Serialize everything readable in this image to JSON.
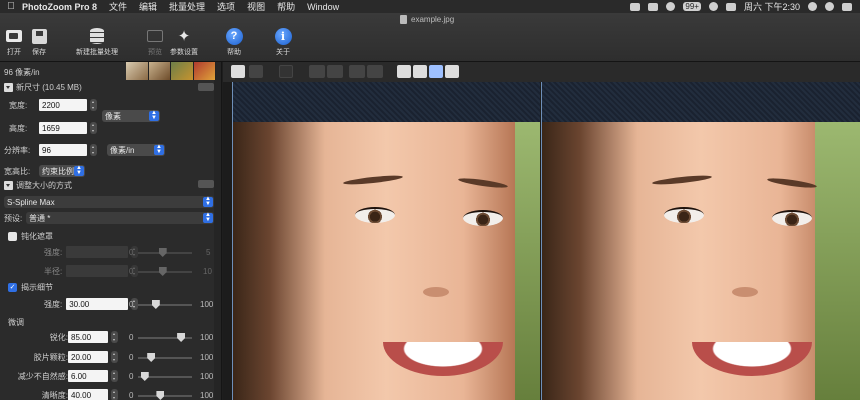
{
  "menubar": {
    "apple": "",
    "app_name": "PhotoZoom Pro 8",
    "menus": [
      "文件",
      "编辑",
      "批量处理",
      "选项",
      "视图",
      "帮助",
      "Window"
    ],
    "notif_badge": "99+",
    "clock": "周六 下午2:30"
  },
  "window": {
    "title": "example.jpg"
  },
  "toolbar": {
    "open": "打开",
    "save": "保存",
    "batch": "新建批量处理",
    "preview": "预览",
    "params": "参数设置",
    "help": "帮助",
    "about": "关于"
  },
  "panel": {
    "resolution_top": "96 像素/in",
    "new_size_title": "新尺寸 (10.45 MB)",
    "width_label": "宽度:",
    "width_value": "2200",
    "height_label": "高度:",
    "height_value": "1659",
    "unit_select": "像素",
    "resolution_label": "分辨率:",
    "resolution_value": "96",
    "resolution_unit": "像素/in",
    "aspect_label": "宽高比:",
    "aspect_select": "约束比例",
    "method_title": "调整大小的方式",
    "method_select": "S-Spline Max",
    "preset_label": "预设:",
    "preset_select": "普通 *",
    "unsharp_label": "钝化遮罩",
    "strength_label": "强度:",
    "radius_label": "半径:",
    "unsharp_min": "0",
    "unsharp_strength_max": "5",
    "unsharp_radius_max": "10",
    "reveal_label": "揭示细节",
    "reveal_strength_label": "强度:",
    "reveal_strength_value": "30.00",
    "fine_tune_label": "微调",
    "sharpen_label": "锐化:",
    "sharpen_value": "85.00",
    "grain_label": "胶片颗粒:",
    "grain_value": "20.00",
    "artifact_label": "减少不自然感:",
    "artifact_value": "6.00",
    "clarity_label": "清晰度:",
    "clarity_value": "40.00",
    "min": "0",
    "max": "100"
  },
  "levels": {
    "unsharp_strength": 0.45,
    "unsharp_radius": 0.45,
    "reveal_strength": 0.3,
    "sharpen": 0.85,
    "grain": 0.2,
    "artifact": 0.06,
    "clarity": 0.4
  }
}
